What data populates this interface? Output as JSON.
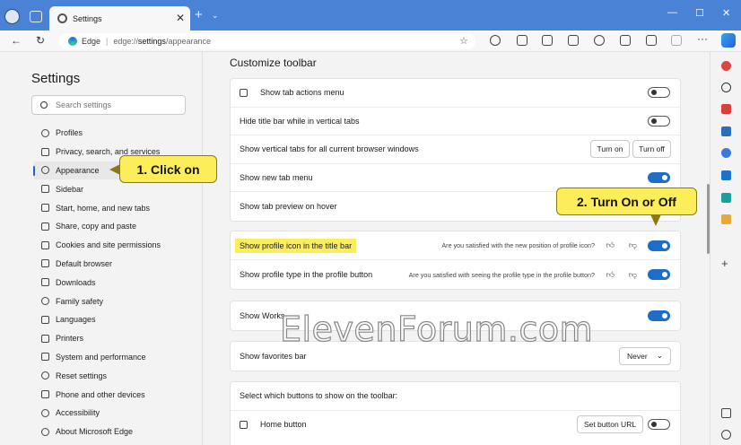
{
  "browser": {
    "tab_title": "Settings",
    "tab_close": "✕",
    "new_tab": "+",
    "tab_menu": "⌄",
    "window_controls": {
      "minimize": "—",
      "maximize": "☐",
      "close": "✕"
    },
    "url_site": "Edge",
    "url_separator": "|",
    "url_prefix": "edge://",
    "url_bold": "settings",
    "url_rest": "/appearance",
    "nav_back": "←",
    "nav_refresh": "↻",
    "favorite": "☆",
    "more": "···",
    "sidebar_add": "+"
  },
  "sidebar": {
    "title": "Settings",
    "search_placeholder": "Search settings",
    "items": [
      {
        "label": "Profiles",
        "icon": "profile-icon"
      },
      {
        "label": "Privacy, search, and services",
        "icon": "lock-icon"
      },
      {
        "label": "Appearance",
        "icon": "palette-icon",
        "active": true
      },
      {
        "label": "Sidebar",
        "icon": "sidebar-icon"
      },
      {
        "label": "Start, home, and new tabs",
        "icon": "home-icon"
      },
      {
        "label": "Share, copy and paste",
        "icon": "share-icon"
      },
      {
        "label": "Cookies and site permissions",
        "icon": "cookie-icon"
      },
      {
        "label": "Default browser",
        "icon": "browser-icon"
      },
      {
        "label": "Downloads",
        "icon": "download-icon"
      },
      {
        "label": "Family safety",
        "icon": "family-icon"
      },
      {
        "label": "Languages",
        "icon": "language-icon"
      },
      {
        "label": "Printers",
        "icon": "printer-icon"
      },
      {
        "label": "System and performance",
        "icon": "system-icon"
      },
      {
        "label": "Reset settings",
        "icon": "reset-icon"
      },
      {
        "label": "Phone and other devices",
        "icon": "phone-icon"
      },
      {
        "label": "Accessibility",
        "icon": "accessibility-icon"
      },
      {
        "label": "About Microsoft Edge",
        "icon": "edge-icon"
      }
    ]
  },
  "main": {
    "section_title": "Customize toolbar",
    "card1": [
      {
        "label": "Show tab actions menu",
        "state": "off"
      },
      {
        "label": "Hide title bar while in vertical tabs",
        "state": "off"
      },
      {
        "label": "Show vertical tabs for all current browser windows",
        "btn1": "Turn on",
        "btn2": "Turn off"
      },
      {
        "label": "Show new tab menu",
        "state": "on"
      },
      {
        "label": "Show tab preview on hover",
        "state": "on"
      }
    ],
    "card2": [
      {
        "label": "Show profile icon in the title bar",
        "question": "Are you satisfied with the new position of profile icon?",
        "state": "on"
      },
      {
        "label": "Show profile type in the profile button",
        "question": "Are you satisfied with seeing the profile type in the profile button?",
        "state": "on"
      }
    ],
    "workspaces_label": "Show Works",
    "favorites_label": "Show favorites bar",
    "favorites_value": "Never",
    "buttons_heading": "Select which buttons to show on the toolbar:",
    "home_button_label": "Home button",
    "home_button_action": "Set button URL"
  },
  "callouts": {
    "step1": "1. Click on",
    "step2": "2. Turn On or Off"
  },
  "watermark": "ElevenForum.com",
  "colors": {
    "accent": "#1f6dc8",
    "titlebar": "#4a83d6",
    "highlight": "#fbee5a"
  }
}
